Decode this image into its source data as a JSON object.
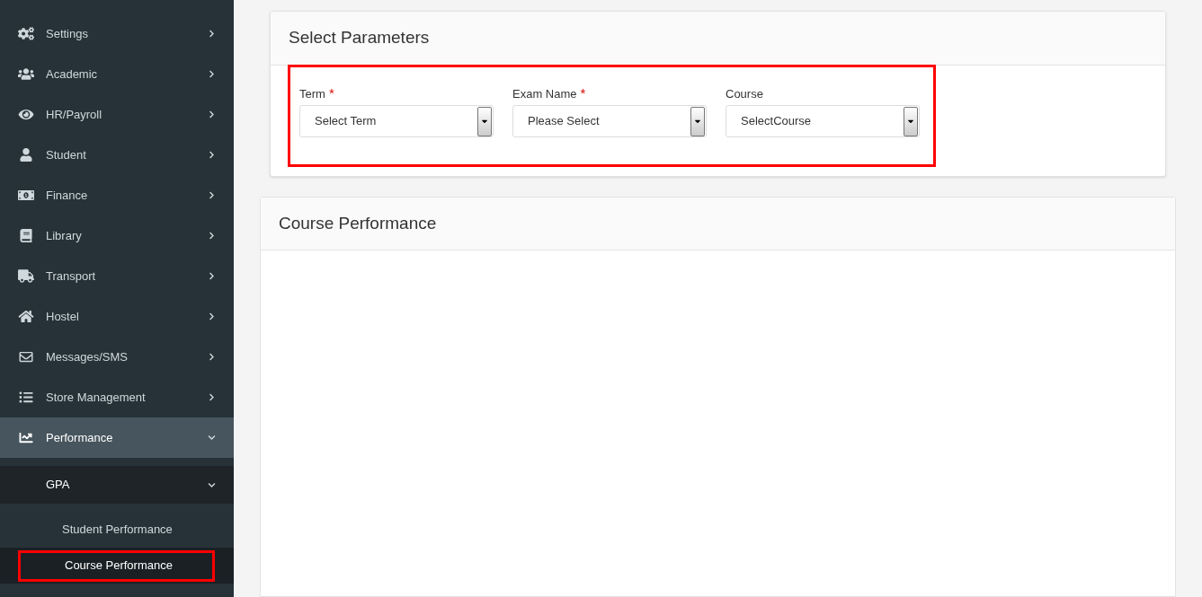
{
  "sidebar": {
    "items": [
      {
        "label": "Settings",
        "selected": false,
        "expanded": false
      },
      {
        "label": "Academic",
        "selected": false,
        "expanded": false
      },
      {
        "label": "HR/Payroll",
        "selected": false,
        "expanded": false
      },
      {
        "label": "Student",
        "selected": false,
        "expanded": false
      },
      {
        "label": "Finance",
        "selected": false,
        "expanded": false
      },
      {
        "label": "Library",
        "selected": false,
        "expanded": false
      },
      {
        "label": "Transport",
        "selected": false,
        "expanded": false
      },
      {
        "label": "Hostel",
        "selected": false,
        "expanded": false
      },
      {
        "label": "Messages/SMS",
        "selected": false,
        "expanded": false
      },
      {
        "label": "Store Management",
        "selected": false,
        "expanded": false
      },
      {
        "label": "Performance",
        "selected": true,
        "expanded": true,
        "children": [
          {
            "label": "GPA",
            "expanded": true,
            "children": [
              {
                "label": "Student Performance",
                "selected": false,
                "highlighted": false
              },
              {
                "label": "Course Performance",
                "selected": true,
                "highlighted": true
              }
            ]
          }
        ]
      }
    ]
  },
  "parameters": {
    "title": "Select Parameters",
    "highlighted": true,
    "fields": [
      {
        "label": "Term",
        "required_marker": "*",
        "value": "Select Term"
      },
      {
        "label": "Exam Name",
        "required_marker": "*",
        "value": "Please Select"
      },
      {
        "label": "Course",
        "value": "SelectCourse"
      }
    ]
  },
  "result": {
    "title": "Course Performance"
  }
}
